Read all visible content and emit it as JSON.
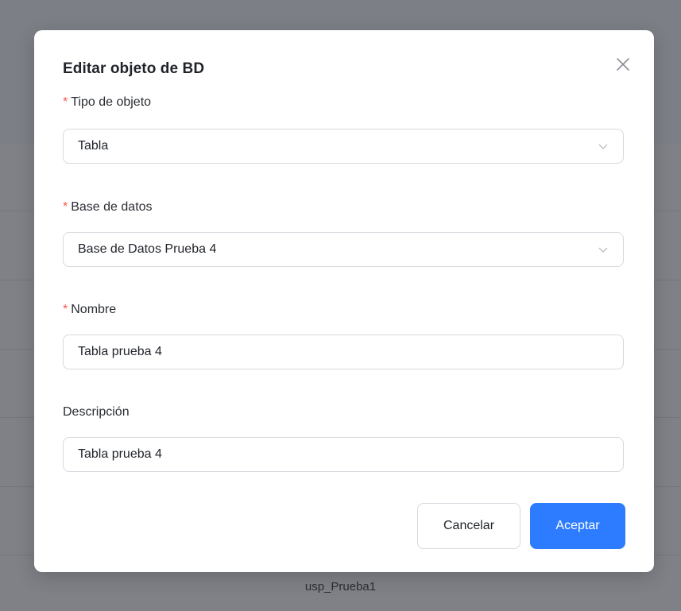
{
  "background": {
    "row_text": "usp_Prueba1"
  },
  "modal": {
    "title": "Editar objeto de BD",
    "close_icon": "close-icon",
    "required_marker": "*",
    "fields": {
      "object_type": {
        "label": "Tipo de objeto",
        "value": "Tabla",
        "required": true
      },
      "database": {
        "label": "Base de datos",
        "value": "Base de Datos Prueba 4",
        "required": true
      },
      "name": {
        "label": "Nombre",
        "value": "Tabla prueba 4",
        "required": true
      },
      "description": {
        "label": "Descripción",
        "value": "Tabla prueba 4",
        "required": false
      }
    },
    "buttons": {
      "cancel": "Cancelar",
      "accept": "Aceptar"
    }
  },
  "colors": {
    "primary": "#2d7cff",
    "required": "#f5574b",
    "overlay": "#7f8187"
  }
}
